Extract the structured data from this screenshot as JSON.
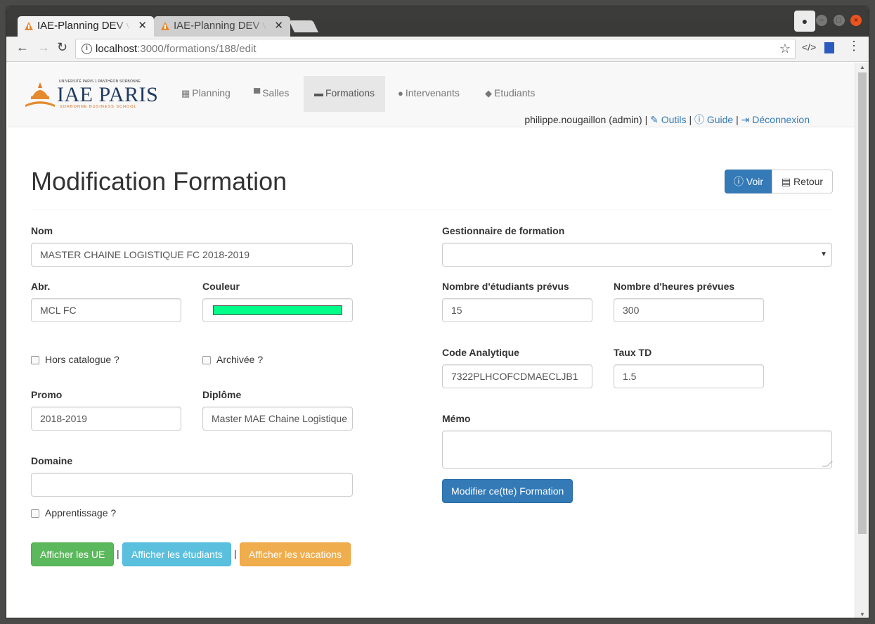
{
  "browser": {
    "tabs": [
      {
        "title": "IAE-Planning DEV v"
      },
      {
        "title": "IAE-Planning DEV v"
      }
    ],
    "url_host": "localhost",
    "url_path": ":3000/formations/188/edit",
    "close_glyph": "✕",
    "accent": "#e9541f"
  },
  "nav": {
    "logo": {
      "top": "UNIVERSITÉ PARIS 1 PANTHÉON SORBONNE",
      "main": "IAE PARIS",
      "sub": "SORBONNE BUSINESS SCHOOL"
    },
    "items": [
      {
        "label": "Planning",
        "icon": "calendar-icon"
      },
      {
        "label": "Salles",
        "icon": "desk-icon"
      },
      {
        "label": "Formations",
        "icon": "briefcase-icon"
      },
      {
        "label": "Intervenants",
        "icon": "user-icon"
      },
      {
        "label": "Etudiants",
        "icon": "graduation-cap-icon"
      }
    ],
    "user": "philippe.nougaillon (admin)",
    "sep": "|",
    "outils": "Outils",
    "guide": "Guide",
    "deconnexion": "Déconnexion"
  },
  "page": {
    "title": "Modification Formation",
    "voir": "Voir",
    "retour": "Retour"
  },
  "form": {
    "nom": {
      "label": "Nom",
      "value": "MASTER CHAINE LOGISTIQUE FC 2018-2019"
    },
    "abr": {
      "label": "Abr.",
      "value": "MCL FC"
    },
    "couleur": {
      "label": "Couleur",
      "value": "#00ff88"
    },
    "hors_catalogue": {
      "label": "Hors catalogue ?",
      "checked": false
    },
    "archivee": {
      "label": "Archivée ?",
      "checked": false
    },
    "promo": {
      "label": "Promo",
      "value": "2018-2019"
    },
    "diplome": {
      "label": "Diplôme",
      "value": "Master MAE Chaine Logistique"
    },
    "domaine": {
      "label": "Domaine",
      "value": ""
    },
    "apprentissage": {
      "label": "Apprentissage ?",
      "checked": false
    },
    "gestionnaire": {
      "label": "Gestionnaire de formation",
      "value": ""
    },
    "nb_etudiants": {
      "label": "Nombre d'étudiants prévus",
      "value": "15"
    },
    "nb_heures": {
      "label": "Nombre d'heures prévues",
      "value": "300"
    },
    "code_analytique": {
      "label": "Code Analytique",
      "value": "7322PLHCOFCDMAECLJB1"
    },
    "taux_td": {
      "label": "Taux TD",
      "value": "1.5"
    },
    "memo": {
      "label": "Mémo",
      "value": ""
    },
    "submit": "Modifier ce(tte) Formation"
  },
  "actions": {
    "ue": "Afficher les UE",
    "etudiants": "Afficher les étudiants",
    "vacations": "Afficher les vacations",
    "sep": "|"
  }
}
